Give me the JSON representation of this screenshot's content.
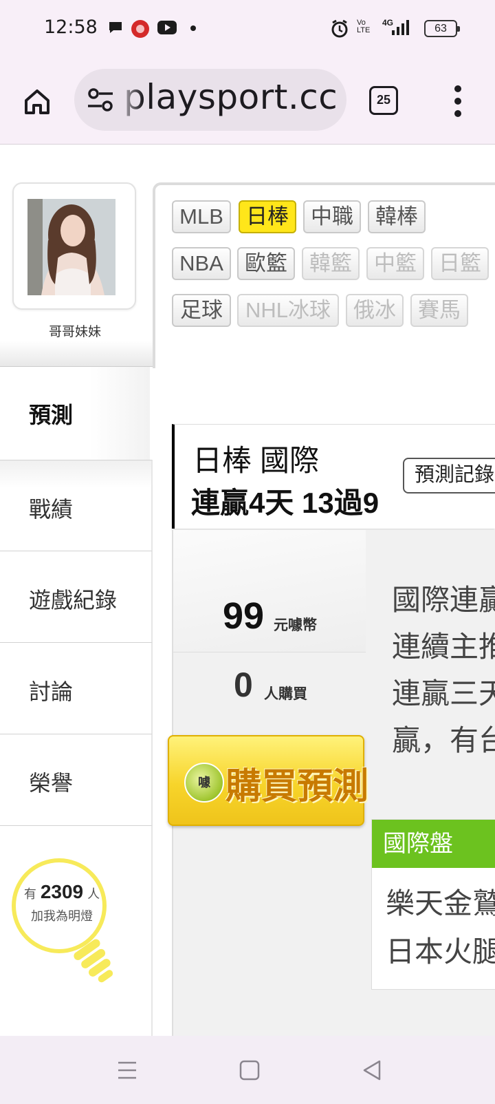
{
  "status_bar": {
    "time": "12:58",
    "network": "4G",
    "lte": "Vo LTE",
    "battery": "63"
  },
  "browser": {
    "url": "playsport.cc",
    "tab_count": "25"
  },
  "profile": {
    "nickname": "哥哥妹妹"
  },
  "sidebar": {
    "active": "預測",
    "items": [
      {
        "label": "戰績"
      },
      {
        "label": "遊戲紀錄"
      },
      {
        "label": "討論"
      },
      {
        "label": "榮譽"
      }
    ],
    "lamp": {
      "prefix": "有",
      "count": "2309",
      "suffix": "人",
      "line2": "加我為明燈"
    }
  },
  "leagues": {
    "row1": [
      {
        "label": "MLB",
        "state": "normal"
      },
      {
        "label": "日棒",
        "state": "active"
      },
      {
        "label": "中職",
        "state": "normal"
      },
      {
        "label": "韓棒",
        "state": "normal"
      }
    ],
    "row2": [
      {
        "label": "NBA",
        "state": "normal"
      },
      {
        "label": "歐籃",
        "state": "normal"
      },
      {
        "label": "韓籃",
        "state": "disabled"
      },
      {
        "label": "中籃",
        "state": "disabled"
      },
      {
        "label": "日籃",
        "state": "disabled"
      }
    ],
    "row3": [
      {
        "label": "足球",
        "state": "normal"
      },
      {
        "label": "NHL冰球",
        "state": "disabled"
      },
      {
        "label": "俄冰",
        "state": "disabled"
      },
      {
        "label": "賽馬",
        "state": "disabled"
      }
    ]
  },
  "prediction": {
    "title": "日棒 國際",
    "streak": "連贏4天 13過9",
    "record_button": "預測記錄",
    "price": "99",
    "price_unit": "元噱幣",
    "buyers": "0",
    "buyers_unit": "人購買",
    "buy_button": "購買預測",
    "coin_label": "噱",
    "description_lines": [
      "國際連贏",
      "連續主推",
      "連贏三天",
      "贏，有台"
    ],
    "market_header": "國際盤",
    "market_lines": [
      "樂天金鷲",
      "日本火腿"
    ]
  },
  "colors": {
    "active_league": "#ffe61a",
    "buy_button": "#f7d42a",
    "market_header": "#6cc21f",
    "lamp": "#f7ea5a"
  }
}
